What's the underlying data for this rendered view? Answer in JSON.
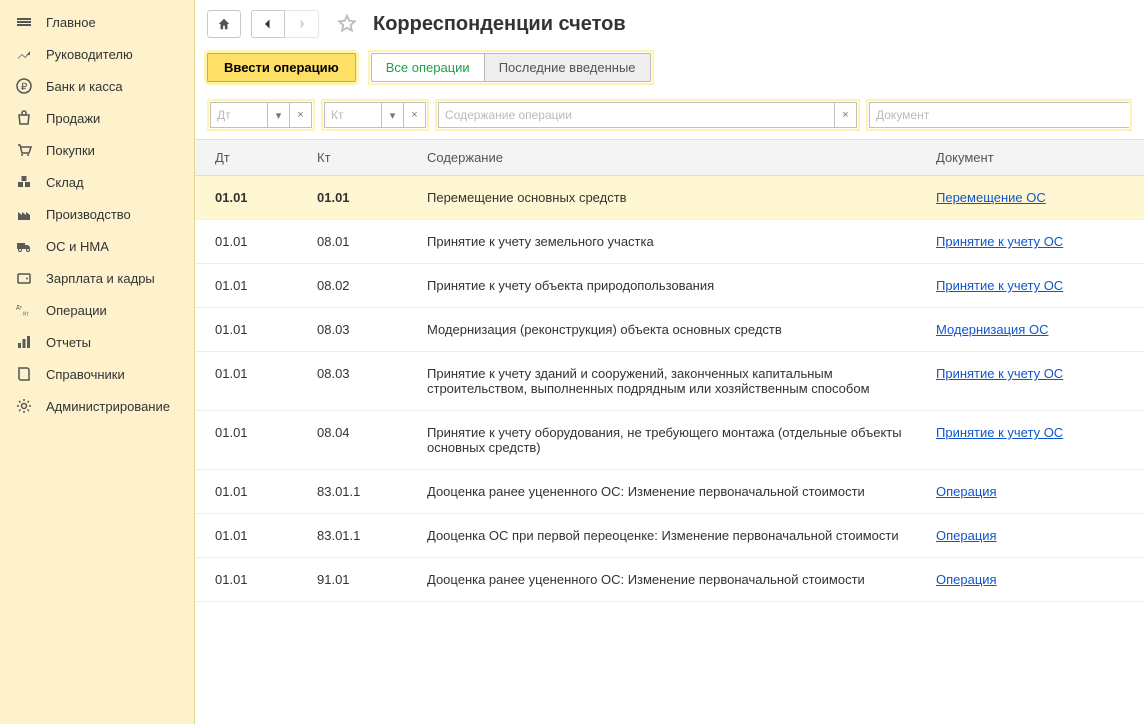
{
  "sidebar": {
    "items": [
      {
        "icon": "menu",
        "label": "Главное"
      },
      {
        "icon": "trend",
        "label": "Руководителю"
      },
      {
        "icon": "ruble",
        "label": "Банк и касса"
      },
      {
        "icon": "bag",
        "label": "Продажи"
      },
      {
        "icon": "cart",
        "label": "Покупки"
      },
      {
        "icon": "boxes",
        "label": "Склад"
      },
      {
        "icon": "factory",
        "label": "Производство"
      },
      {
        "icon": "truck",
        "label": "ОС и НМА"
      },
      {
        "icon": "wallet",
        "label": "Зарплата и кадры"
      },
      {
        "icon": "dtkt",
        "label": "Операции"
      },
      {
        "icon": "chart",
        "label": "Отчеты"
      },
      {
        "icon": "book",
        "label": "Справочники"
      },
      {
        "icon": "gear",
        "label": "Администрирование"
      }
    ]
  },
  "header": {
    "title": "Корреспонденции счетов"
  },
  "toolbar": {
    "primary": "Ввести операцию",
    "toggle_all": "Все операции",
    "toggle_recent": "Последние введенные"
  },
  "filters": {
    "dt_placeholder": "Дт",
    "kt_placeholder": "Кт",
    "content_placeholder": "Содержание операции",
    "doc_placeholder": "Документ"
  },
  "table": {
    "headers": {
      "dt": "Дт",
      "kt": "Кт",
      "content": "Содержание",
      "doc": "Документ"
    },
    "rows": [
      {
        "dt": "01.01",
        "kt": "01.01",
        "content": "Перемещение основных средств",
        "doc": "Перемещение ОС",
        "selected": true
      },
      {
        "dt": "01.01",
        "kt": "08.01",
        "content": "Принятие к учету земельного участка",
        "doc": "Принятие к учету ОС"
      },
      {
        "dt": "01.01",
        "kt": "08.02",
        "content": "Принятие к учету объекта природопользования",
        "doc": "Принятие к учету ОС"
      },
      {
        "dt": "01.01",
        "kt": "08.03",
        "content": "Модернизация (реконструкция) объекта основных средств",
        "doc": "Модернизация ОС"
      },
      {
        "dt": "01.01",
        "kt": "08.03",
        "content": "Принятие к учету зданий и сооружений, законченных капитальным строительством, выполненных подрядным или хозяйственным способом",
        "doc": "Принятие к учету ОС"
      },
      {
        "dt": "01.01",
        "kt": "08.04",
        "content": "Принятие к учету оборудования, не требующего монтажа (отдельные объекты основных средств)",
        "doc": "Принятие к учету ОС"
      },
      {
        "dt": "01.01",
        "kt": "83.01.1",
        "content": "Дооценка ранее уцененного ОС: Изменение первоначальной стоимости",
        "doc": "Операция"
      },
      {
        "dt": "01.01",
        "kt": "83.01.1",
        "content": "Дооценка ОС при первой переоценке: Изменение первоначальной стоимости",
        "doc": "Операция"
      },
      {
        "dt": "01.01",
        "kt": "91.01",
        "content": "Дооценка ранее уцененного ОС: Изменение первоначальной стоимости",
        "doc": "Операция"
      }
    ]
  }
}
